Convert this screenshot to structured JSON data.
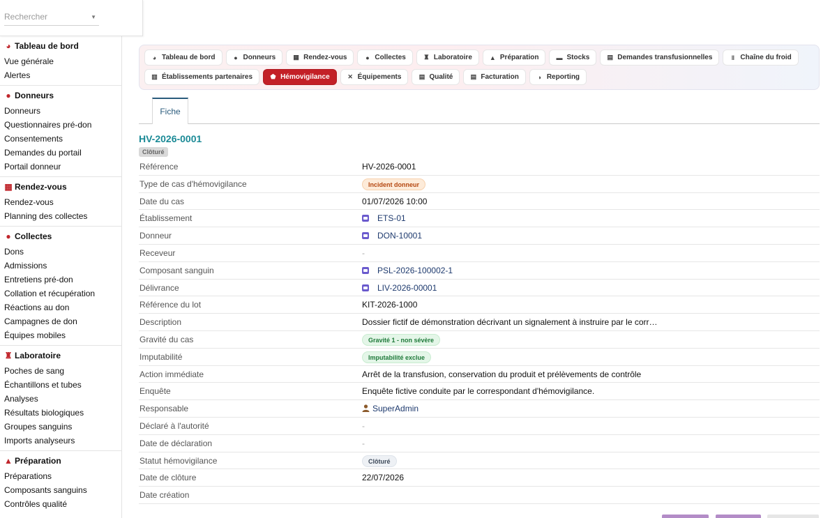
{
  "search": {
    "placeholder": "Rechercher"
  },
  "sidebar": {
    "sections": [
      {
        "title": "Tableau de bord",
        "icon": "dashboard-icon",
        "items": [
          "Vue générale",
          "Alertes"
        ]
      },
      {
        "title": "Donneurs",
        "icon": "user-icon",
        "items": [
          "Donneurs",
          "Questionnaires pré-don",
          "Consentements",
          "Demandes du portail",
          "Portail donneur"
        ]
      },
      {
        "title": "Rendez-vous",
        "icon": "calendar-icon",
        "items": [
          "Rendez-vous",
          "Planning des collectes"
        ]
      },
      {
        "title": "Collectes",
        "icon": "blood-drop-icon",
        "items": [
          "Dons",
          "Admissions",
          "Entretiens pré-don",
          "Collation et récupération",
          "Réactions au don",
          "Campagnes de don",
          "Équipes mobiles"
        ]
      },
      {
        "title": "Laboratoire",
        "icon": "microscope-icon",
        "items": [
          "Poches de sang",
          "Échantillons et tubes",
          "Analyses",
          "Résultats biologiques",
          "Groupes sanguins",
          "Imports analyseurs"
        ]
      },
      {
        "title": "Préparation",
        "icon": "flask-icon",
        "items": [
          "Préparations",
          "Composants sanguins",
          "Contrôles qualité"
        ]
      }
    ]
  },
  "nav": {
    "row1": [
      {
        "label": "Tableau de bord",
        "icon": "dashboard-icon"
      },
      {
        "label": "Donneurs",
        "icon": "user-icon"
      },
      {
        "label": "Rendez-vous",
        "icon": "calendar-icon"
      },
      {
        "label": "Collectes",
        "icon": "blood-drop-icon"
      },
      {
        "label": "Laboratoire",
        "icon": "microscope-icon"
      },
      {
        "label": "Préparation",
        "icon": "flask-icon"
      },
      {
        "label": "Stocks",
        "icon": "warehouse-icon"
      },
      {
        "label": "Demandes transfusionnelles",
        "icon": "document-icon"
      },
      {
        "label": "Chaîne du froid",
        "icon": "thermometer-icon"
      }
    ],
    "row2": [
      {
        "label": "Établissements partenaires",
        "icon": "building-icon"
      },
      {
        "label": "Hémovigilance",
        "icon": "shield-icon",
        "active": true
      },
      {
        "label": "Équipements",
        "icon": "tools-icon"
      },
      {
        "label": "Qualité",
        "icon": "clipboard-icon"
      },
      {
        "label": "Facturation",
        "icon": "invoice-icon"
      },
      {
        "label": "Reporting",
        "icon": "chart-pie-icon"
      }
    ],
    "active_color": "#c32027"
  },
  "tabs": {
    "fiche": "Fiche"
  },
  "record": {
    "title": "HV-2026-0001",
    "state": "Clôturé",
    "fields": [
      {
        "label": "Référence",
        "value": "HV-2026-0001",
        "type": "text"
      },
      {
        "label": "Type de cas d'hémovigilance",
        "value": "Incident donneur",
        "type": "badge-orange"
      },
      {
        "label": "Date du cas",
        "value": "01/07/2026 10:00",
        "type": "text"
      },
      {
        "label": "Établissement",
        "value": "ETS-01",
        "type": "link"
      },
      {
        "label": "Donneur",
        "value": "DON-10001",
        "type": "link"
      },
      {
        "label": "Receveur",
        "value": "-",
        "type": "empty"
      },
      {
        "label": "Composant sanguin",
        "value": "PSL-2026-100002-1",
        "type": "link"
      },
      {
        "label": "Délivrance",
        "value": "LIV-2026-00001",
        "type": "link"
      },
      {
        "label": "Référence du lot",
        "value": "KIT-2026-1000",
        "type": "text"
      },
      {
        "label": "Description",
        "value": "Dossier fictif de démonstration décrivant un signalement à instruire par le corr…",
        "type": "text"
      },
      {
        "label": "Gravité du cas",
        "value": "Gravité 1 - non sévère",
        "type": "badge-green"
      },
      {
        "label": "Imputabilité",
        "value": "Imputabilité exclue",
        "type": "badge-green"
      },
      {
        "label": "Action immédiate",
        "value": "Arrêt de la transfusion, conservation du produit et prélèvements de contrôle",
        "type": "text"
      },
      {
        "label": "Enquête",
        "value": "Enquête fictive conduite par le correspondant d'hémovigilance.",
        "type": "text"
      },
      {
        "label": "Responsable",
        "value": "SuperAdmin",
        "type": "user"
      },
      {
        "label": "Déclaré à l'autorité",
        "value": "-",
        "type": "empty"
      },
      {
        "label": "Date de déclaration",
        "value": "-",
        "type": "empty"
      },
      {
        "label": "Statut hémovigilance",
        "value": "Clôturé",
        "type": "badge-grey"
      },
      {
        "label": "Date de clôture",
        "value": "22/07/2026",
        "type": "text"
      },
      {
        "label": "Date création",
        "value": "",
        "type": "text"
      }
    ]
  }
}
